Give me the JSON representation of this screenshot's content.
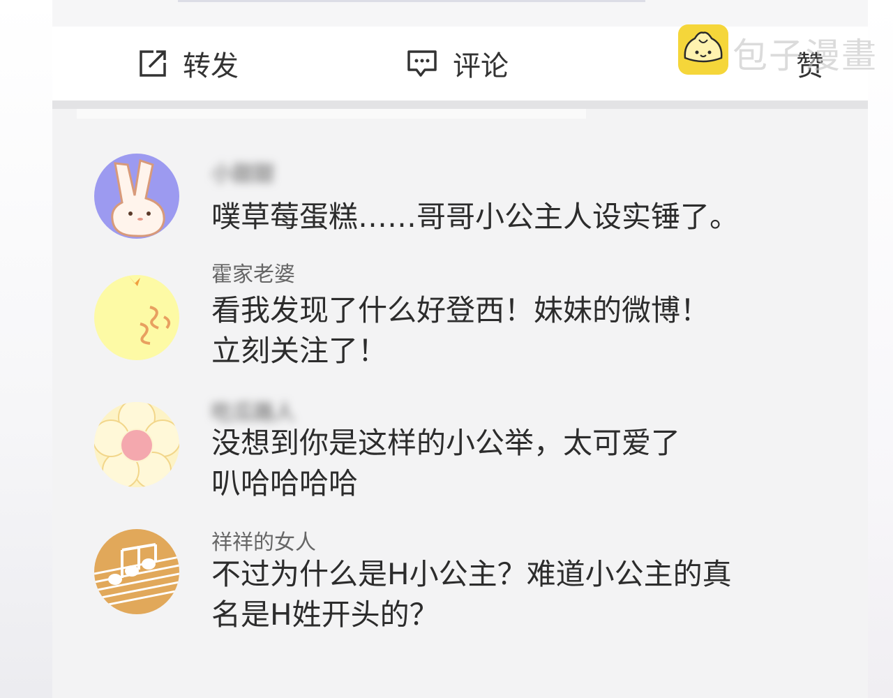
{
  "actions": {
    "repost_label": "转发",
    "comment_label": "评论",
    "like_label": "赞"
  },
  "watermark": "包子漫畫",
  "comments": [
    {
      "username": "小甜甜",
      "lines": [
        "噗草莓蛋糕……哥哥小公主人设实锤了。"
      ]
    },
    {
      "username": "霍家老婆",
      "lines": [
        "看我发现了什么好登西！妹妹的微博！",
        "立刻关注了！"
      ]
    },
    {
      "username": "吃瓜路人",
      "lines": [
        "没想到你是这样的小公举，太可爱了",
        "叭哈哈哈哈"
      ]
    },
    {
      "username": "祥祥的女人",
      "lines": [
        "不过为什么是H小公主？难道小公主的真",
        "名是H姓开头的？"
      ]
    }
  ],
  "icons": [
    "repost-icon",
    "comment-icon",
    "like-icon",
    "logo-icon"
  ]
}
